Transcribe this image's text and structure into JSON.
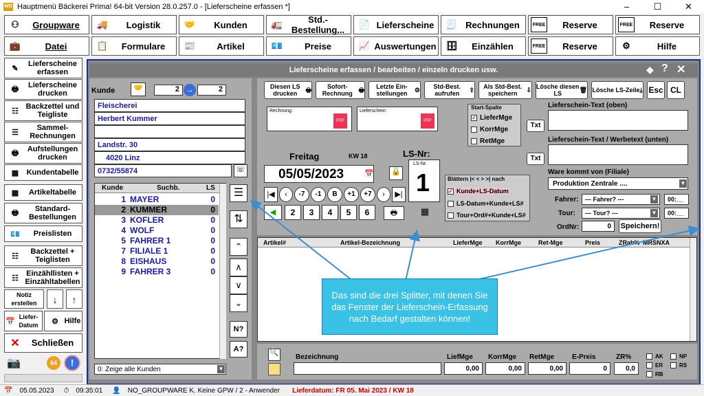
{
  "window": {
    "title": "Hauptmenü Bäckerei Prima! 64-bit Version 28.0.257.0 - [Lieferscheine erfassen *]",
    "icon_text": "WD"
  },
  "topnav": {
    "row1": [
      "Groupware",
      "Logistik",
      "Kunden",
      "Std.-Bestellung...",
      "Lieferscheine",
      "Rechnungen",
      "Reserve",
      "Reserve"
    ],
    "row2": [
      "Datei",
      "Formulare",
      "Artikel",
      "Preise",
      "Auswertungen",
      "Einzählen",
      "Reserve",
      "Hilfe"
    ],
    "free_badge": "FREE"
  },
  "sidebar": [
    "Lieferscheine erfassen",
    "Lieferscheine drucken",
    "Backzettel und Teigliste",
    "Sammel-Rechnungen",
    "Aufstellungen drucken",
    "Kundentabelle",
    "Artikeltabelle",
    "Standard-Bestellungen",
    "Preislisten",
    "Backzettel + Teiglisten",
    "Einzähllisten + Einzähltabellen"
  ],
  "sidebar_small": {
    "notiz": "Notiz erstellen",
    "liefer": "Liefer-Datum",
    "hilfe": "Hilfe",
    "close": "Schließen",
    "badge64": "64",
    "alert": "!"
  },
  "panel": {
    "title": "Lieferscheine erfassen / bearbeiten / einzeln drucken usw.",
    "help": "?",
    "close": "✕"
  },
  "kunde": {
    "label": "Kunde",
    "from": "2",
    "to": "2",
    "lines": [
      "Fleischerei",
      "Herbert Kummer",
      "",
      "Landstr. 30",
      "4020 Linz",
      "0732/55874"
    ]
  },
  "klist": {
    "headers": [
      "Kunde",
      "Suchb.",
      "LS"
    ],
    "rows": [
      {
        "n": "1",
        "name": "MAYER",
        "ls": "0"
      },
      {
        "n": "2",
        "name": "KUMMER",
        "ls": "0"
      },
      {
        "n": "3",
        "name": "KOFLER",
        "ls": "0"
      },
      {
        "n": "4",
        "name": "WOLF",
        "ls": "0"
      },
      {
        "n": "5",
        "name": "FAHRER 1",
        "ls": "0"
      },
      {
        "n": "7",
        "name": "FILIALE 1",
        "ls": "0"
      },
      {
        "n": "8",
        "name": "EISHAUS",
        "ls": "0"
      },
      {
        "n": "9",
        "name": "FAHRER 3",
        "ls": "0"
      }
    ],
    "filter": "0: Zeige alle Kunden"
  },
  "sidebtns": {
    "n": "N?",
    "a": "A?"
  },
  "toolbar": [
    "Diesen LS drucken",
    "Sofort-Rechnung",
    "Letzte Ein-stellungen",
    "Std-Best. aufrufen",
    "Als Std-Best. speichern",
    "Lösche diesen LS",
    "Lösche LS-Zeile",
    "Esc",
    "CL"
  ],
  "docs": {
    "rechnung": "Rechnung:",
    "lieferschein": "Lieferschein:",
    "pdf": "PDF"
  },
  "startspalte": {
    "title": "Start-Spalte",
    "items": [
      "LieferMge",
      "KorrMge",
      "RetMge"
    ],
    "checked": 0
  },
  "date": {
    "weekday": "Freitag",
    "kw": "KW 18",
    "value": "05/05/2023",
    "lsnr_label": "LS-Nr:",
    "lsnr_small": "LS-Nr.",
    "lsnr": "1"
  },
  "navbtns": [
    "-7",
    "-1",
    "B",
    "+1",
    "+7"
  ],
  "numbtns": [
    "2",
    "3",
    "4",
    "5",
    "6"
  ],
  "blaettern": {
    "title": "Blättern |< < > >| nach",
    "items": [
      "Kunde+LS-Datum",
      "LS-Datum+Kunde+LS#",
      "Tour+Ord#+Kunde+LS#"
    ],
    "checked": 0
  },
  "texts": {
    "oben": "Lieferschein-Text (oben)",
    "unten": "Lieferschein-Text / Werbetext (unten)",
    "txt": "Txt"
  },
  "filiale": {
    "label": "Ware kommt von (Filiale)",
    "value": "Produktion Zentrale ...."
  },
  "fahrer": {
    "label": "Fahrer:",
    "value": "--- Fahrer? ---",
    "time": "00:__"
  },
  "tour": {
    "label": "Tour:",
    "value": "--- Tour? ---",
    "time": "00:__"
  },
  "ordnr": {
    "label": "OrdNr:",
    "value": "0",
    "save": "Speichern!"
  },
  "grid": {
    "headers": [
      "Artikel#",
      "Artikel-Bezeichnung",
      "LieferMge",
      "KorrMge",
      "Ret-Mge",
      "Preis",
      "ZRab%",
      "MRSNXA"
    ]
  },
  "footer": {
    "labels": [
      "Bezeichnung",
      "LiefMge",
      "KorrMge",
      "RetMge",
      "E-Preis",
      "ZR%"
    ],
    "values": [
      "0,00",
      "0,00",
      "0,00",
      "0",
      "0,0"
    ],
    "flags": [
      "AK",
      "NP",
      "ER",
      "RS",
      "RB"
    ]
  },
  "callout": "Das sind die drei Splitter, mit denen Sie das Fenster der Lieferschein-Erfassung nach Bedarf gestalten können!",
  "status": {
    "date": "05.05.2023",
    "time": "09:35:01",
    "user": "NO_GROUPWARE K. Keine GPW /  2 - Anwender",
    "liefer": "Lieferdatum: FR 05. Mai 2023 / KW 18"
  }
}
